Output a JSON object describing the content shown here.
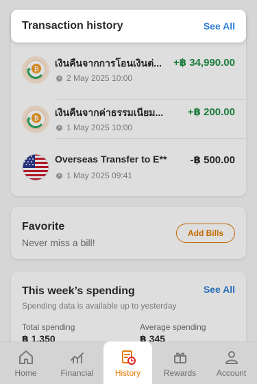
{
  "transactions": {
    "title": "Transaction history",
    "see_all": "See All",
    "items": [
      {
        "name": "เงินคืนจากการโอนเงินต่...",
        "amount": "+฿ 34,990.00",
        "time": "2 May 2025 10:00",
        "icon": "cashback-icon",
        "direction": "in"
      },
      {
        "name": "เงินคืนจากค่าธรรมเนียม...",
        "amount": "+฿ 200.00",
        "time": "1 May 2025 10:00",
        "icon": "cashback-icon",
        "direction": "in"
      },
      {
        "name": "Overseas Transfer to E**",
        "amount": "-฿ 500.00",
        "time": "1 May 2025 09:41",
        "icon": "us-flag-icon",
        "direction": "out"
      }
    ]
  },
  "favorite": {
    "title": "Favorite",
    "subtitle": "Never miss a bill!",
    "button": "Add Bills"
  },
  "spending": {
    "title": "This week’s spending",
    "see_all": "See All",
    "subtitle": "Spending data is available up to yesterday",
    "total_label": "Total spending",
    "total_value": "฿ 1,350",
    "avg_label": "Average spending",
    "avg_value": "฿ 345"
  },
  "nav": {
    "items": [
      {
        "label": "Home",
        "icon": "home-icon"
      },
      {
        "label": "Financial",
        "icon": "financial-icon"
      },
      {
        "label": "History",
        "icon": "history-icon",
        "active": true
      },
      {
        "label": "Rewards",
        "icon": "rewards-icon"
      },
      {
        "label": "Account",
        "icon": "account-icon"
      }
    ]
  },
  "colors": {
    "accent": "#e07a00",
    "link": "#2f7fd6",
    "positive": "#1f8f46"
  }
}
